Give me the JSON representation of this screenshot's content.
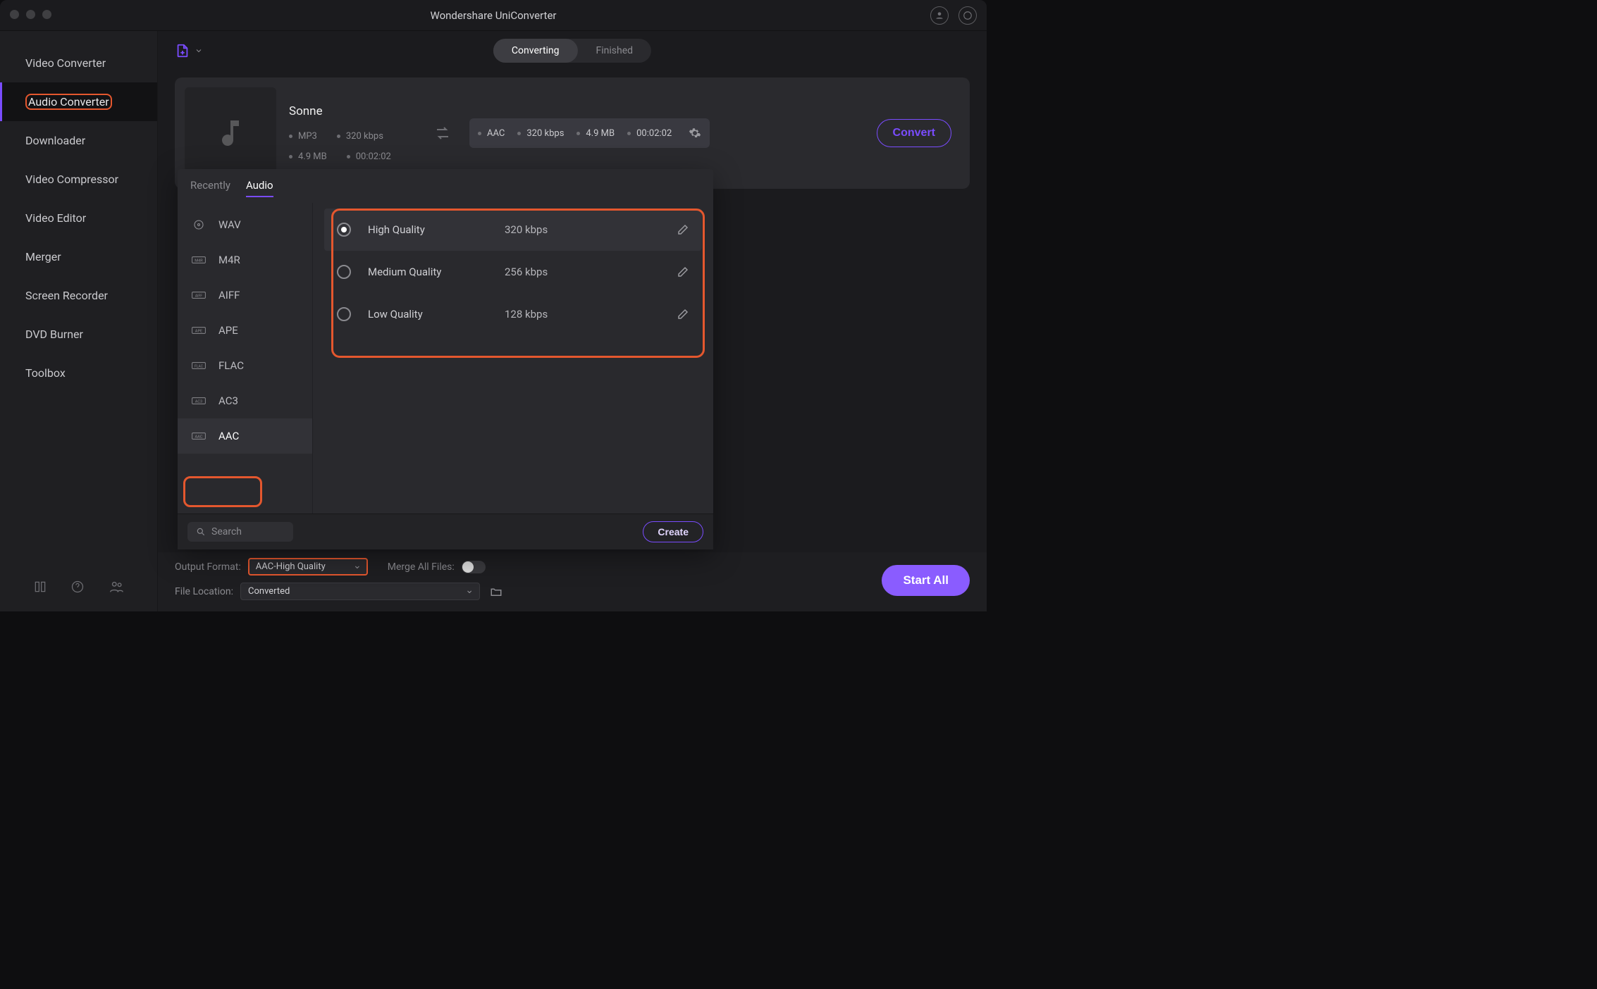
{
  "title": "Wondershare UniConverter",
  "sidebar": {
    "items": [
      {
        "label": "Video Converter"
      },
      {
        "label": "Audio Converter"
      },
      {
        "label": "Downloader"
      },
      {
        "label": "Video Compressor"
      },
      {
        "label": "Video Editor"
      },
      {
        "label": "Merger"
      },
      {
        "label": "Screen Recorder"
      },
      {
        "label": "DVD Burner"
      },
      {
        "label": "Toolbox"
      }
    ]
  },
  "tabs": {
    "converting": "Converting",
    "finished": "Finished"
  },
  "file": {
    "name": "Sonne",
    "src": {
      "codec": "MP3",
      "bitrate": "320 kbps",
      "size": "4.9 MB",
      "duration": "00:02:02"
    },
    "dst": {
      "codec": "AAC",
      "bitrate": "320 kbps",
      "size": "4.9 MB",
      "duration": "00:02:02"
    },
    "convert_label": "Convert"
  },
  "popover": {
    "tabs": {
      "recently": "Recently",
      "audio": "Audio"
    },
    "formats": [
      "WAV",
      "M4R",
      "AIFF",
      "APE",
      "FLAC",
      "AC3",
      "AAC"
    ],
    "qualities": [
      {
        "name": "High Quality",
        "rate": "320 kbps",
        "selected": true
      },
      {
        "name": "Medium Quality",
        "rate": "256 kbps",
        "selected": false
      },
      {
        "name": "Low Quality",
        "rate": "128 kbps",
        "selected": false
      }
    ],
    "search_placeholder": "Search",
    "create": "Create"
  },
  "bottombar": {
    "output_format_label": "Output Format:",
    "output_format_value": "AAC-High Quality",
    "merge_label": "Merge All Files:",
    "file_location_label": "File Location:",
    "file_location_value": "Converted",
    "start_all": "Start All"
  }
}
